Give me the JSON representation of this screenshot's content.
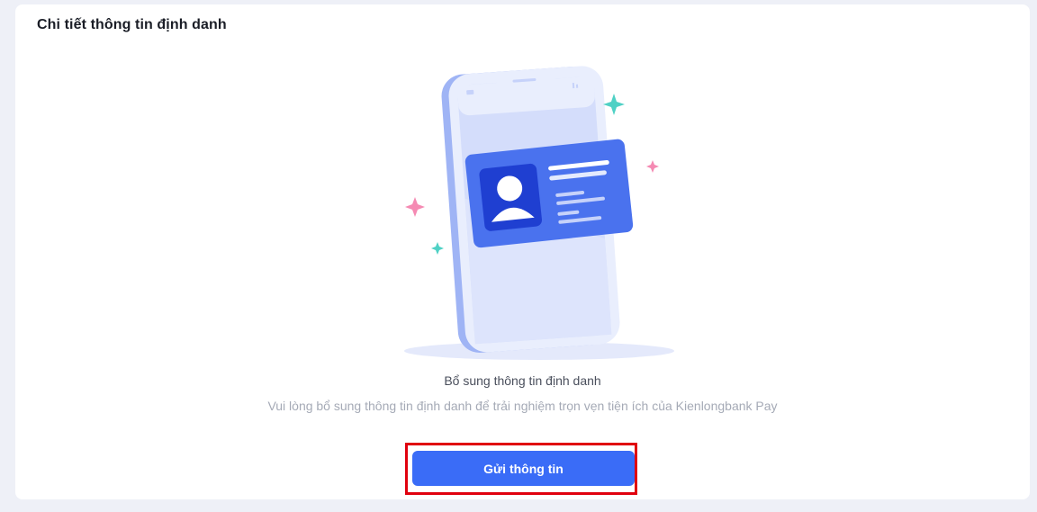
{
  "card": {
    "title": "Chi tiết thông tin định danh"
  },
  "empty_state": {
    "illustration_icon": "phone-id-card-icon",
    "subtitle": "Bổ sung thông tin định danh",
    "description": "Vui lòng bổ sung thông tin định danh để trải nghiệm trọn vẹn tiện ích của Kienlongbank Pay"
  },
  "actions": {
    "submit_label": "Gửi thông tin"
  },
  "colors": {
    "accent": "#3a6cf7",
    "highlight": "#e0000e",
    "page_bg": "#eef0f7"
  }
}
